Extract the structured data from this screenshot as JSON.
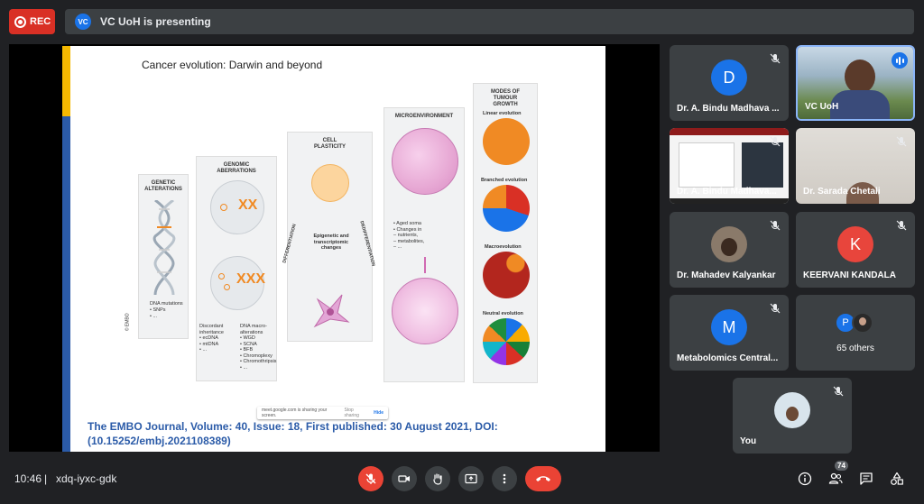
{
  "recording": {
    "label": "REC"
  },
  "presenter_bar": {
    "avatar_initials": "VC",
    "text": "VC UoH is presenting"
  },
  "slide": {
    "title": "Cancer evolution: Darwin and beyond",
    "citation": "The EMBO Journal, Volume: 40, Issue: 18, First published: 30 August 2021, DOI: (10.15252/embj.2021108389)",
    "watermark": "© EMBO",
    "figure": {
      "panels": [
        {
          "heading": "GENETIC ALTERATIONS",
          "notes": [
            "DNA mutations",
            "• SNPs",
            "• ..."
          ]
        },
        {
          "heading": "GENOMIC ABERRATIONS",
          "notes_left": [
            "Discordant inheritance",
            "• ecDNA",
            "• mtDNA",
            "• ..."
          ],
          "notes_right": [
            "DNA macro-alterations",
            "• WGD",
            "• SCNA",
            "• BFB",
            "• Chromoplexy",
            "• Chromothripsis",
            "• ..."
          ]
        },
        {
          "heading": "CELL PLASTICITY",
          "center": "Epigenetic and transcriptomic changes",
          "left_arrow": "DIFFERENTIATION",
          "right_arrow": "DEDIFFERENTIATION"
        },
        {
          "heading": "MICROENVIRONMENT",
          "notes": [
            "• Aged soma",
            "• Changes in",
            "– nutrients,",
            "– metabolites,",
            "– ..."
          ]
        },
        {
          "heading": "MODES OF TUMOUR GROWTH",
          "modes": [
            "Linear evolution",
            "Branched evolution",
            "Macroevolution",
            "Neutral evolution"
          ]
        }
      ]
    }
  },
  "share_notice": {
    "text": "meet.google.com is sharing your screen.",
    "stop": "Stop sharing",
    "hide": "Hide"
  },
  "participants": [
    {
      "name": "Dr. A. Bindu Madhava ...",
      "initial": "D",
      "color": "#1a73e8",
      "muted": true
    },
    {
      "name": "VC UoH",
      "speaking": true
    },
    {
      "name": "Dr. A. Bindu Madhava...",
      "muted": true
    },
    {
      "name": "Dr. Sarada Chetali",
      "muted": true
    },
    {
      "name": "Dr. Mahadev Kalyankar",
      "muted": true
    },
    {
      "name": "KEERVANI KANDALA",
      "initial": "K",
      "color": "#e8453c",
      "muted": true
    },
    {
      "name": "Metabolomics Central...",
      "initial": "M",
      "color": "#1a73e8",
      "muted": true
    },
    {
      "name": "65 others",
      "initial": "P",
      "color": "#1a73e8"
    },
    {
      "name": "You",
      "muted": true
    }
  ],
  "bottom_bar": {
    "time": "10:46",
    "separator": "|",
    "meeting_code": "xdq-iyxc-gdk",
    "people_count": "74"
  },
  "colors": {
    "accent": "#1a73e8",
    "danger": "#ea4335",
    "surface": "#3c4043",
    "background": "#202124"
  }
}
